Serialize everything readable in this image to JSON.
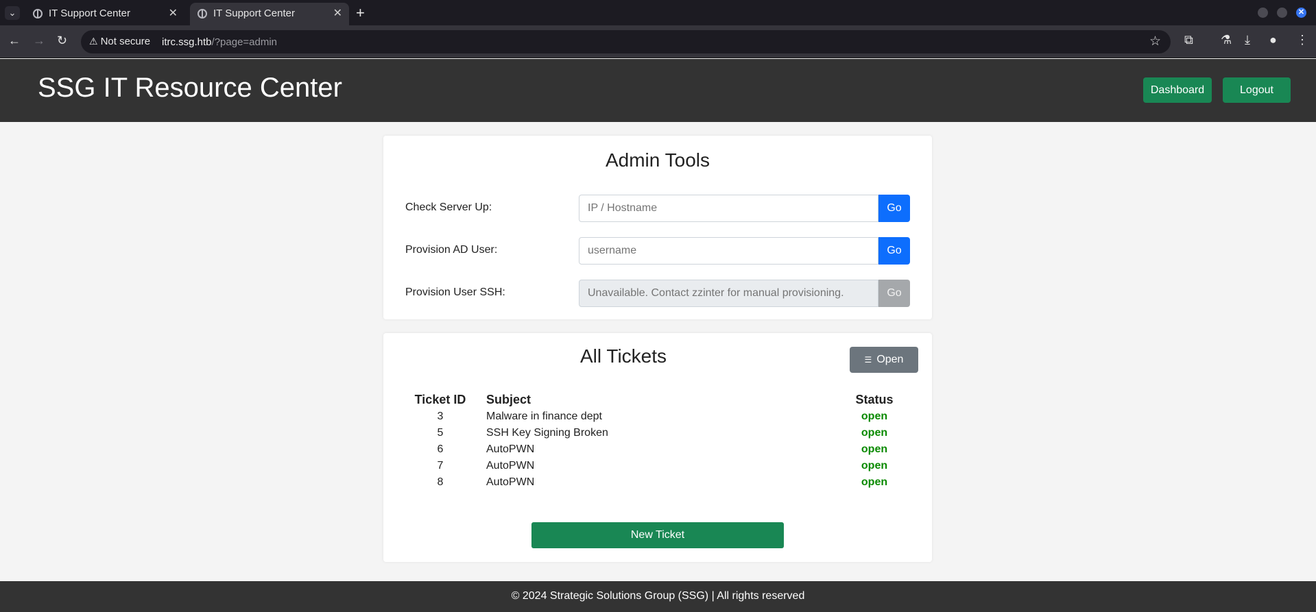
{
  "browser": {
    "tabs": [
      {
        "title": "IT Support Center",
        "active": false
      },
      {
        "title": "IT Support Center",
        "active": true
      }
    ],
    "security_label": "Not secure",
    "url_host": "itrc.ssg.htb",
    "url_path": "/?page=admin"
  },
  "header": {
    "title": "SSG IT Resource Center",
    "dashboard_label": "Dashboard",
    "logout_label": "Logout"
  },
  "admin_tools": {
    "title": "Admin Tools",
    "rows": [
      {
        "label": "Check Server Up:",
        "placeholder": "IP / Hostname",
        "button": "Go",
        "disabled": false
      },
      {
        "label": "Provision AD User:",
        "placeholder": "username",
        "button": "Go",
        "disabled": false
      },
      {
        "label": "Provision User SSH:",
        "placeholder": "Unavailable. Contact zzinter for manual provisioning.",
        "button": "Go",
        "disabled": true
      }
    ]
  },
  "tickets": {
    "title": "All Tickets",
    "filter_label": "Open",
    "columns": [
      "Ticket ID",
      "Subject",
      "Status"
    ],
    "rows": [
      {
        "id": "3",
        "subject": "Malware in finance dept",
        "status": "open"
      },
      {
        "id": "5",
        "subject": "SSH Key Signing Broken",
        "status": "open"
      },
      {
        "id": "6",
        "subject": "AutoPWN",
        "status": "open"
      },
      {
        "id": "7",
        "subject": "AutoPWN",
        "status": "open"
      },
      {
        "id": "8",
        "subject": "AutoPWN",
        "status": "open"
      }
    ],
    "new_ticket_label": "New Ticket"
  },
  "footer": {
    "text": "© 2024 Strategic Solutions Group (SSG) | All rights reserved"
  },
  "colors": {
    "header_bg": "#333333",
    "primary": "#0d6efd",
    "success": "#198754",
    "status_open": "#0a8a00"
  }
}
